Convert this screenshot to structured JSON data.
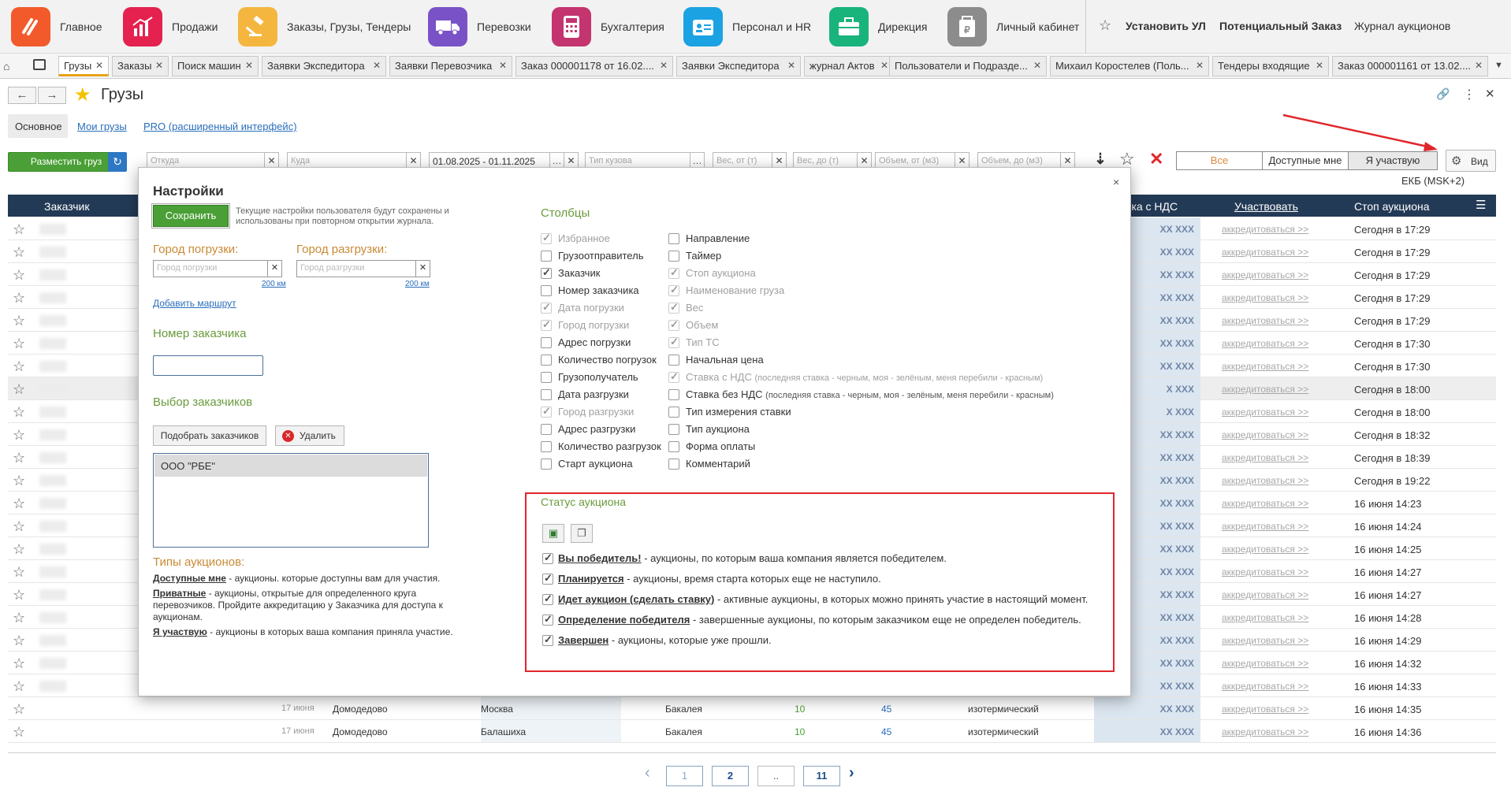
{
  "apps": [
    {
      "label": "Главное",
      "color": "#f25a2b",
      "icon": "logo-icon"
    },
    {
      "label": "Продажи",
      "color": "#e4214f",
      "icon": "chart-icon"
    },
    {
      "label": "Заказы,  Грузы, Тендеры",
      "color": "#f4b63f",
      "icon": "gavel-icon"
    },
    {
      "label": "Перевозки",
      "color": "#7a52c7",
      "icon": "truck-icon"
    },
    {
      "label": "Бухгалтерия",
      "color": "#c4346f",
      "icon": "calculator-icon"
    },
    {
      "label": "Персонал и HR",
      "color": "#1ba2e3",
      "icon": "badge-icon"
    },
    {
      "label": "Дирекция",
      "color": "#19b37c",
      "icon": "briefcase-icon"
    },
    {
      "label": "Личный кабинет",
      "color": "#8c8c8c",
      "icon": "wallet-icon"
    }
  ],
  "top_links": {
    "install": "Установить УЛ",
    "potential": "Потенциальный Заказ",
    "journal": "Журнал аукционов"
  },
  "tabs": [
    "Грузы",
    "Заказы",
    "Поиск машин",
    "Заявки Экспедитора",
    "Заявки Перевозчика",
    "Заказ 000001178 от 16.02....",
    "Заявки Экспедитора",
    "журнал Актов",
    "Пользователи и Подразде...",
    "Михаил Коростелев (Поль...",
    "Тендеры входящие",
    "Заказ 000001161 от 13.02...."
  ],
  "header": {
    "title": "Грузы",
    "tabs": [
      "Основное",
      "Мои грузы",
      "PRO (расширенный интерфейс)"
    ]
  },
  "filters": {
    "place_btn": "Разместить груз",
    "from": "Откуда",
    "to": "Куда",
    "dates": "01.08.2025 - 01.11.2025",
    "body": "Тип кузова",
    "w_from": "Вес, от (т)",
    "w_to": "Вес, до (т)",
    "v_from": "Объем, от (м3)",
    "v_to": "Объем, до (м3)",
    "seg": [
      "Все",
      "Доступные мне",
      "Я участвую"
    ],
    "view": "Вид",
    "tz": "ЕКБ (MSK+2)"
  },
  "grid": {
    "headers": {
      "customer": "Заказчик",
      "ndc": "вка с НДС",
      "participate": "Участвовать",
      "stop": "Стоп аукциона"
    },
    "rows": [
      {
        "ndc": "XX XXX",
        "acc": "аккредитоваться >>",
        "stop": "Сегодня в 17:29"
      },
      {
        "ndc": "XX XXX",
        "acc": "аккредитоваться >>",
        "stop": "Сегодня в 17:29"
      },
      {
        "ndc": "XX XXX",
        "acc": "аккредитоваться >>",
        "stop": "Сегодня в 17:29"
      },
      {
        "ndc": "XX XXX",
        "acc": "аккредитоваться >>",
        "stop": "Сегодня в 17:29"
      },
      {
        "ndc": "XX XXX",
        "acc": "аккредитоваться >>",
        "stop": "Сегодня в 17:29"
      },
      {
        "ndc": "XX XXX",
        "acc": "аккредитоваться >>",
        "stop": "Сегодня в 17:30"
      },
      {
        "ndc": "XX XXX",
        "acc": "аккредитоваться >>",
        "stop": "Сегодня в 17:30"
      },
      {
        "ndc": "X XXX",
        "acc": "аккредитоваться >>",
        "stop": "Сегодня в 18:00"
      },
      {
        "ndc": "X XXX",
        "acc": "аккредитоваться >>",
        "stop": "Сегодня в 18:00"
      },
      {
        "ndc": "XX XXX",
        "acc": "аккредитоваться >>",
        "stop": "Сегодня в 18:32"
      },
      {
        "ndc": "XX XXX",
        "acc": "аккредитоваться >>",
        "stop": "Сегодня в 18:39"
      },
      {
        "ndc": "XX XXX",
        "acc": "аккредитоваться >>",
        "stop": "Сегодня в 19:22"
      },
      {
        "ndc": "XX XXX",
        "acc": "аккредитоваться >>",
        "stop": "16 июня 14:23"
      },
      {
        "ndc": "XX XXX",
        "acc": "аккредитоваться >>",
        "stop": "16 июня 14:24"
      },
      {
        "ndc": "XX XXX",
        "acc": "аккредитоваться >>",
        "stop": "16 июня 14:25"
      },
      {
        "ndc": "XX XXX",
        "acc": "аккредитоваться >>",
        "stop": "16 июня 14:27"
      },
      {
        "ndc": "XX XXX",
        "acc": "аккредитоваться >>",
        "stop": "16 июня 14:27"
      },
      {
        "ndc": "XX XXX",
        "acc": "аккредитоваться >>",
        "stop": "16 июня 14:28"
      },
      {
        "ndc": "XX XXX",
        "acc": "аккредитоваться >>",
        "stop": "16 июня 14:29"
      },
      {
        "ndc": "XX XXX",
        "acc": "аккредитоваться >>",
        "stop": "16 июня 14:32"
      },
      {
        "ndc": "XX XXX",
        "acc": "аккредитоваться >>",
        "stop": "16 июня 14:33"
      },
      {
        "date": "17 июня",
        "from": "Домодедово",
        "to": "Москва",
        "cargo": "Бакалея",
        "w": "10",
        "v": "45",
        "body": "изотермический",
        "ndc": "XX XXX",
        "acc": "аккредитоваться >>",
        "stop": "16 июня 14:35"
      },
      {
        "date": "17 июня",
        "from": "Домодедово",
        "to": "Балашиха",
        "cargo": "Бакалея",
        "w": "10",
        "v": "45",
        "body": "изотермический",
        "ndc": "XX XXX",
        "acc": "аккредитоваться >>",
        "stop": "16 июня 14:36"
      }
    ]
  },
  "modal": {
    "title": "Настройки",
    "save": "Сохранить",
    "save_note": "Текущие настройки пользователя будут сохранены и использованы при повторном открытии журнала.",
    "city_load": "Город погрузки:",
    "city_unload": "Город разгрузки:",
    "city_load_ph": "Город погрузки",
    "city_unload_ph": "Город разгрузки",
    "km": "200 км",
    "add_route": "Добавить маршрут",
    "cust_num": "Номер заказчика",
    "choose_cust": "Выбор заказчиков",
    "pick": "Подобрать заказчиков",
    "delete": "Удалить",
    "selected_customer": "ООО \"РБЕ\"",
    "types_title": "Типы аукционов:",
    "types": [
      {
        "name": "Доступные мне",
        "text": " - аукционы. которые доступны вам для участия."
      },
      {
        "name": "Приватные",
        "text": " - аукционы, открытые для определенного круга перевозчиков. Пройдите аккредитацию у Заказчика для доступа к аукционам."
      },
      {
        "name": "Я участвую",
        "text": " - аукционы в которых ваша компания приняла участие."
      }
    ],
    "columns_title": "Столбцы",
    "col_left": [
      {
        "label": "Избранное",
        "on": true,
        "dis": true
      },
      {
        "label": "Грузоотправитель",
        "on": false,
        "dis": false
      },
      {
        "label": "Заказчик",
        "on": true,
        "dis": false
      },
      {
        "label": "Номер заказчика",
        "on": false,
        "dis": false
      },
      {
        "label": "Дата погрузки",
        "on": true,
        "dis": true
      },
      {
        "label": "Город погрузки",
        "on": true,
        "dis": true
      },
      {
        "label": "Адрес погрузки",
        "on": false,
        "dis": false
      },
      {
        "label": "Количество погрузок",
        "on": false,
        "dis": false
      },
      {
        "label": "Грузополучатель",
        "on": false,
        "dis": false
      },
      {
        "label": "Дата разгрузки",
        "on": false,
        "dis": false
      },
      {
        "label": "Город разгрузки",
        "on": true,
        "dis": true
      },
      {
        "label": "Адрес разгрузки",
        "on": false,
        "dis": false
      },
      {
        "label": "Количество разгрузок",
        "on": false,
        "dis": false
      },
      {
        "label": "Старт аукциона",
        "on": false,
        "dis": false
      }
    ],
    "col_right": [
      {
        "label": "Направление",
        "on": false,
        "dis": false
      },
      {
        "label": "Таймер",
        "on": false,
        "dis": false
      },
      {
        "label": "Стоп аукциона",
        "on": true,
        "dis": true
      },
      {
        "label": "Наименование груза",
        "on": true,
        "dis": true
      },
      {
        "label": "Вес",
        "on": true,
        "dis": true
      },
      {
        "label": "Объем",
        "on": true,
        "dis": true
      },
      {
        "label": "Тип ТС",
        "on": true,
        "dis": true
      },
      {
        "label": "Начальная цена",
        "on": false,
        "dis": false
      },
      {
        "label": "Ставка с НДС",
        "note": "(последняя ставка - черным, моя - зелёным, меня перебили - красным)",
        "on": true,
        "dis": true
      },
      {
        "label": "Ставка без НДС",
        "note": "(последняя ставка - черным,  моя - зелёным, меня перебили - красным)",
        "on": false,
        "dis": false
      },
      {
        "label": "Тип измерения ставки",
        "on": false,
        "dis": false
      },
      {
        "label": "Тип аукциона",
        "on": false,
        "dis": false
      },
      {
        "label": "Форма оплаты",
        "on": false,
        "dis": false
      },
      {
        "label": "Комментарий",
        "on": false,
        "dis": false
      }
    ],
    "status_title": "Статус аукциона",
    "statuses": [
      {
        "name": "Вы победитель!",
        "text": " - аукционы, по которым ваша компания является победителем."
      },
      {
        "name": "Планируется",
        "text": " - аукционы, время старта которых еще не наступило."
      },
      {
        "name": "Идет аукцион (сделать ставку)",
        "text": " - активные аукционы, в которых можно принять участие в настоящий момент."
      },
      {
        "name": "Определение победителя",
        "text": " - завершенные аукционы, по которым заказчиком еще не определен победитель."
      },
      {
        "name": "Завершен",
        "text": " - аукционы, которые уже прошли."
      }
    ]
  },
  "pager": {
    "pages": [
      "1",
      "2",
      "..",
      "11"
    ]
  },
  "accent_red": "#e0262b"
}
